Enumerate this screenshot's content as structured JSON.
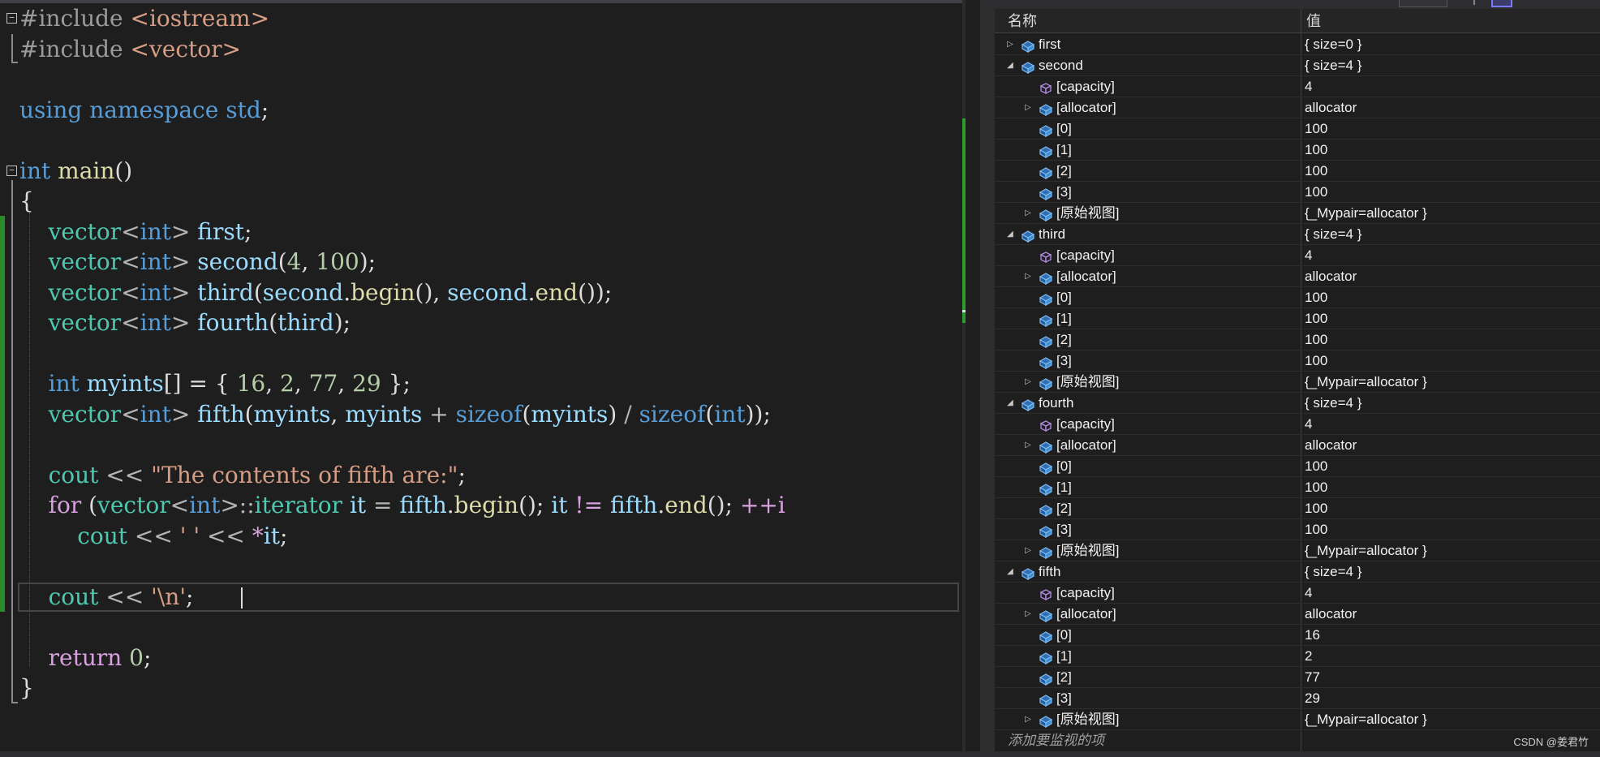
{
  "editor": {
    "lines": [
      {
        "fold": "minus",
        "tokens": [
          {
            "c": "pp",
            "t": "#include "
          },
          {
            "c": "st",
            "t": "<iostream>"
          }
        ]
      },
      {
        "tokens": [
          {
            "c": "pp",
            "t": "#include "
          },
          {
            "c": "st",
            "t": "<vector>"
          }
        ]
      },
      {
        "tokens": []
      },
      {
        "tokens": [
          {
            "c": "kw",
            "t": "using namespace "
          },
          {
            "c": "kw",
            "t": "std"
          },
          {
            "c": "ac",
            "t": ";"
          }
        ]
      },
      {
        "tokens": []
      },
      {
        "fold": "minus",
        "tokens": [
          {
            "c": "kw",
            "t": "int "
          },
          {
            "c": "fn",
            "t": "main"
          },
          {
            "c": "ac",
            "t": "()"
          }
        ]
      },
      {
        "tokens": [
          {
            "c": "ac",
            "t": "{"
          }
        ]
      },
      {
        "tokens": [
          {
            "c": "ac",
            "t": "    "
          },
          {
            "c": "ty",
            "t": "vector"
          },
          {
            "c": "op",
            "t": "<"
          },
          {
            "c": "kw",
            "t": "int"
          },
          {
            "c": "op",
            "t": "> "
          },
          {
            "c": "va",
            "t": "first"
          },
          {
            "c": "ac",
            "t": ";"
          }
        ]
      },
      {
        "tokens": [
          {
            "c": "ac",
            "t": "    "
          },
          {
            "c": "ty",
            "t": "vector"
          },
          {
            "c": "op",
            "t": "<"
          },
          {
            "c": "kw",
            "t": "int"
          },
          {
            "c": "op",
            "t": "> "
          },
          {
            "c": "va",
            "t": "second"
          },
          {
            "c": "ac",
            "t": "("
          },
          {
            "c": "nu",
            "t": "4"
          },
          {
            "c": "ac",
            "t": ", "
          },
          {
            "c": "nu",
            "t": "100"
          },
          {
            "c": "ac",
            "t": ");"
          }
        ]
      },
      {
        "tokens": [
          {
            "c": "ac",
            "t": "    "
          },
          {
            "c": "ty",
            "t": "vector"
          },
          {
            "c": "op",
            "t": "<"
          },
          {
            "c": "kw",
            "t": "int"
          },
          {
            "c": "op",
            "t": "> "
          },
          {
            "c": "va",
            "t": "third"
          },
          {
            "c": "ac",
            "t": "("
          },
          {
            "c": "va",
            "t": "second"
          },
          {
            "c": "ac",
            "t": "."
          },
          {
            "c": "fn",
            "t": "begin"
          },
          {
            "c": "ac",
            "t": "(), "
          },
          {
            "c": "va",
            "t": "second"
          },
          {
            "c": "ac",
            "t": "."
          },
          {
            "c": "fn",
            "t": "end"
          },
          {
            "c": "ac",
            "t": "());"
          }
        ]
      },
      {
        "tokens": [
          {
            "c": "ac",
            "t": "    "
          },
          {
            "c": "ty",
            "t": "vector"
          },
          {
            "c": "op",
            "t": "<"
          },
          {
            "c": "kw",
            "t": "int"
          },
          {
            "c": "op",
            "t": "> "
          },
          {
            "c": "va",
            "t": "fourth"
          },
          {
            "c": "ac",
            "t": "("
          },
          {
            "c": "va",
            "t": "third"
          },
          {
            "c": "ac",
            "t": ");"
          }
        ]
      },
      {
        "tokens": []
      },
      {
        "tokens": [
          {
            "c": "ac",
            "t": "    "
          },
          {
            "c": "kw",
            "t": "int "
          },
          {
            "c": "va",
            "t": "myints"
          },
          {
            "c": "ac",
            "t": "[] = { "
          },
          {
            "c": "nu",
            "t": "16"
          },
          {
            "c": "ac",
            "t": ", "
          },
          {
            "c": "nu",
            "t": "2"
          },
          {
            "c": "ac",
            "t": ", "
          },
          {
            "c": "nu",
            "t": "77"
          },
          {
            "c": "ac",
            "t": ", "
          },
          {
            "c": "nu",
            "t": "29"
          },
          {
            "c": "ac",
            "t": " };"
          }
        ]
      },
      {
        "tokens": [
          {
            "c": "ac",
            "t": "    "
          },
          {
            "c": "ty",
            "t": "vector"
          },
          {
            "c": "op",
            "t": "<"
          },
          {
            "c": "kw",
            "t": "int"
          },
          {
            "c": "op",
            "t": "> "
          },
          {
            "c": "va",
            "t": "fifth"
          },
          {
            "c": "ac",
            "t": "("
          },
          {
            "c": "va",
            "t": "myints"
          },
          {
            "c": "ac",
            "t": ", "
          },
          {
            "c": "va",
            "t": "myints"
          },
          {
            "c": "op",
            "t": " + "
          },
          {
            "c": "kw",
            "t": "sizeof"
          },
          {
            "c": "ac",
            "t": "("
          },
          {
            "c": "va",
            "t": "myints"
          },
          {
            "c": "ac",
            "t": ") "
          },
          {
            "c": "op",
            "t": "/ "
          },
          {
            "c": "kw",
            "t": "sizeof"
          },
          {
            "c": "ac",
            "t": "("
          },
          {
            "c": "kw",
            "t": "int"
          },
          {
            "c": "ac",
            "t": "));"
          }
        ]
      },
      {
        "tokens": []
      },
      {
        "tokens": [
          {
            "c": "ac",
            "t": "    "
          },
          {
            "c": "ms",
            "t": "cout"
          },
          {
            "c": "op",
            "t": " << "
          },
          {
            "c": "st",
            "t": "\"The contents of fifth are:\""
          },
          {
            "c": "ac",
            "t": ";"
          }
        ]
      },
      {
        "tokens": [
          {
            "c": "ac",
            "t": "    "
          },
          {
            "c": "kw2",
            "t": "for"
          },
          {
            "c": "ac",
            "t": " ("
          },
          {
            "c": "ty",
            "t": "vector"
          },
          {
            "c": "op",
            "t": "<"
          },
          {
            "c": "kw",
            "t": "int"
          },
          {
            "c": "op",
            "t": ">::"
          },
          {
            "c": "ty",
            "t": "iterator"
          },
          {
            "c": "ac",
            "t": " "
          },
          {
            "c": "va",
            "t": "it"
          },
          {
            "c": "op",
            "t": " = "
          },
          {
            "c": "va",
            "t": "fifth"
          },
          {
            "c": "ac",
            "t": "."
          },
          {
            "c": "fn",
            "t": "begin"
          },
          {
            "c": "ac",
            "t": "(); "
          },
          {
            "c": "va",
            "t": "it"
          },
          {
            "c": "kw2",
            "t": " != "
          },
          {
            "c": "va",
            "t": "fifth"
          },
          {
            "c": "ac",
            "t": "."
          },
          {
            "c": "fn",
            "t": "end"
          },
          {
            "c": "ac",
            "t": "(); "
          },
          {
            "c": "kw2",
            "t": "++i"
          }
        ]
      },
      {
        "tokens": [
          {
            "c": "ac",
            "t": "        "
          },
          {
            "c": "ms",
            "t": "cout"
          },
          {
            "c": "op",
            "t": " << "
          },
          {
            "c": "st",
            "t": "' '"
          },
          {
            "c": "op",
            "t": " << "
          },
          {
            "c": "kw2",
            "t": "*"
          },
          {
            "c": "va",
            "t": "it"
          },
          {
            "c": "ac",
            "t": ";"
          }
        ]
      },
      {
        "tokens": []
      },
      {
        "tokens": [
          {
            "c": "ac",
            "t": "    "
          },
          {
            "c": "ms",
            "t": "cout"
          },
          {
            "c": "op",
            "t": " << "
          },
          {
            "c": "st",
            "t": "'\\n'"
          },
          {
            "c": "ac",
            "t": ";"
          }
        ]
      },
      {
        "tokens": []
      },
      {
        "tokens": [
          {
            "c": "ac",
            "t": "    "
          },
          {
            "c": "kw2",
            "t": "return "
          },
          {
            "c": "nu",
            "t": "0"
          },
          {
            "c": "ac",
            "t": ";"
          }
        ]
      },
      {
        "tokens": [
          {
            "c": "ac",
            "t": "}"
          }
        ]
      }
    ]
  },
  "watch": {
    "header_name": "名称",
    "header_value": "值",
    "add_watch_placeholder": "添加要监视的项",
    "rows": [
      {
        "depth": 0,
        "exp": "collapsed",
        "icon": "variable-icon",
        "name": "first",
        "value": "{ size=0 }"
      },
      {
        "depth": 0,
        "exp": "expanded",
        "icon": "variable-icon",
        "name": "second",
        "value": "{ size=4 }"
      },
      {
        "depth": 1,
        "exp": "none",
        "icon": "property-icon",
        "name": "[capacity]",
        "value": "4"
      },
      {
        "depth": 1,
        "exp": "collapsed",
        "icon": "variable-icon",
        "name": "[allocator]",
        "value": "allocator"
      },
      {
        "depth": 1,
        "exp": "none",
        "icon": "variable-icon",
        "name": "[0]",
        "value": "100"
      },
      {
        "depth": 1,
        "exp": "none",
        "icon": "variable-icon",
        "name": "[1]",
        "value": "100"
      },
      {
        "depth": 1,
        "exp": "none",
        "icon": "variable-icon",
        "name": "[2]",
        "value": "100"
      },
      {
        "depth": 1,
        "exp": "none",
        "icon": "variable-icon",
        "name": "[3]",
        "value": "100"
      },
      {
        "depth": 1,
        "exp": "collapsed",
        "icon": "variable-icon",
        "name": "[原始视图]",
        "value": "{_Mypair=allocator }"
      },
      {
        "depth": 0,
        "exp": "expanded",
        "icon": "variable-icon",
        "name": "third",
        "value": "{ size=4 }"
      },
      {
        "depth": 1,
        "exp": "none",
        "icon": "property-icon",
        "name": "[capacity]",
        "value": "4"
      },
      {
        "depth": 1,
        "exp": "collapsed",
        "icon": "variable-icon",
        "name": "[allocator]",
        "value": "allocator"
      },
      {
        "depth": 1,
        "exp": "none",
        "icon": "variable-icon",
        "name": "[0]",
        "value": "100"
      },
      {
        "depth": 1,
        "exp": "none",
        "icon": "variable-icon",
        "name": "[1]",
        "value": "100"
      },
      {
        "depth": 1,
        "exp": "none",
        "icon": "variable-icon",
        "name": "[2]",
        "value": "100"
      },
      {
        "depth": 1,
        "exp": "none",
        "icon": "variable-icon",
        "name": "[3]",
        "value": "100"
      },
      {
        "depth": 1,
        "exp": "collapsed",
        "icon": "variable-icon",
        "name": "[原始视图]",
        "value": "{_Mypair=allocator }"
      },
      {
        "depth": 0,
        "exp": "expanded",
        "icon": "variable-icon",
        "name": "fourth",
        "value": "{ size=4 }"
      },
      {
        "depth": 1,
        "exp": "none",
        "icon": "property-icon",
        "name": "[capacity]",
        "value": "4"
      },
      {
        "depth": 1,
        "exp": "collapsed",
        "icon": "variable-icon",
        "name": "[allocator]",
        "value": "allocator"
      },
      {
        "depth": 1,
        "exp": "none",
        "icon": "variable-icon",
        "name": "[0]",
        "value": "100"
      },
      {
        "depth": 1,
        "exp": "none",
        "icon": "variable-icon",
        "name": "[1]",
        "value": "100"
      },
      {
        "depth": 1,
        "exp": "none",
        "icon": "variable-icon",
        "name": "[2]",
        "value": "100"
      },
      {
        "depth": 1,
        "exp": "none",
        "icon": "variable-icon",
        "name": "[3]",
        "value": "100"
      },
      {
        "depth": 1,
        "exp": "collapsed",
        "icon": "variable-icon",
        "name": "[原始视图]",
        "value": "{_Mypair=allocator }"
      },
      {
        "depth": 0,
        "exp": "expanded",
        "icon": "variable-icon",
        "name": "fifth",
        "value": "{ size=4 }"
      },
      {
        "depth": 1,
        "exp": "none",
        "icon": "property-icon",
        "name": "[capacity]",
        "value": "4"
      },
      {
        "depth": 1,
        "exp": "collapsed",
        "icon": "variable-icon",
        "name": "[allocator]",
        "value": "allocator"
      },
      {
        "depth": 1,
        "exp": "none",
        "icon": "variable-icon",
        "name": "[0]",
        "value": "16"
      },
      {
        "depth": 1,
        "exp": "none",
        "icon": "variable-icon",
        "name": "[1]",
        "value": "2"
      },
      {
        "depth": 1,
        "exp": "none",
        "icon": "variable-icon",
        "name": "[2]",
        "value": "77"
      },
      {
        "depth": 1,
        "exp": "none",
        "icon": "variable-icon",
        "name": "[3]",
        "value": "29"
      },
      {
        "depth": 1,
        "exp": "collapsed",
        "icon": "variable-icon",
        "name": "[原始视图]",
        "value": "{_Mypair=allocator }"
      }
    ],
    "watermark": "CSDN @姜君竹"
  },
  "colors": {
    "editor_background": "#1e1e1e",
    "keyword": "#569cd6",
    "control_keyword": "#d8a0df",
    "type": "#4ec9b0",
    "function": "#dcdcaa",
    "variable": "#9cdcfe",
    "number": "#b5cea8",
    "string": "#d69d85",
    "change_marker": "#2a8a2a",
    "variable_icon": "#3b8fd6",
    "property_icon": "#a77bd4"
  }
}
